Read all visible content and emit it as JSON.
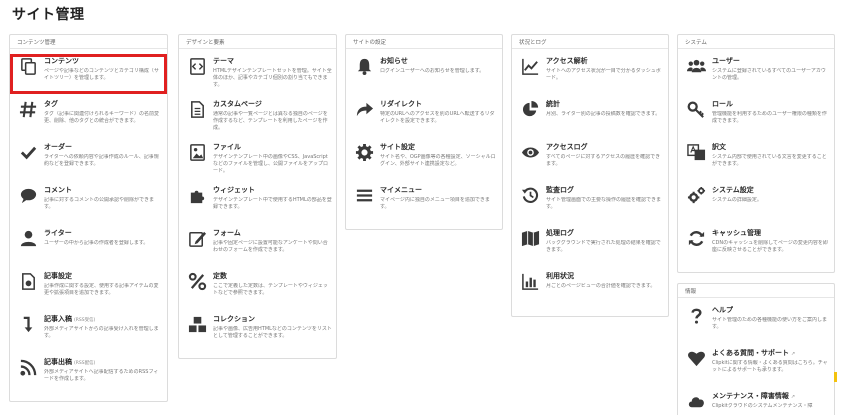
{
  "page": {
    "title": "サイト管理"
  },
  "panels": {
    "content": {
      "header": "コンテンツ管理",
      "items": [
        {
          "title": "コンテンツ",
          "tag": "",
          "desc": "ページや記事などのコンテンツとカテゴリ構成（サイトツリー）を管理します。"
        },
        {
          "title": "タグ",
          "tag": "",
          "desc": "タグ（記事に関連付けられるキーワード）の名前変更、削除、他のタグとの統合ができます。"
        },
        {
          "title": "オーダー",
          "tag": "",
          "desc": "ライターへの依頼内容や記事作成のルール、記事規約などを登録できます。"
        },
        {
          "title": "コメント",
          "tag": "",
          "desc": "記事に対するコメントの公開承認や削除ができます。"
        },
        {
          "title": "ライター",
          "tag": "",
          "desc": "ユーザーの中から記事の作成者を登録します。"
        },
        {
          "title": "記事設定",
          "tag": "",
          "desc": "記事作成に関する設定、使用する記事アイテムの変更や拡張項目を追加できます。"
        },
        {
          "title": "記事入稿",
          "tag": "(RSS受信)",
          "desc": "外部メディアサイトからの記事受け入れを管理します。"
        },
        {
          "title": "記事出稿",
          "tag": "(RSS配信)",
          "desc": "外部メディアサイトへ記事配信するためのRSSフィードを作成します。"
        }
      ]
    },
    "design": {
      "header": "デザインと要素",
      "items": [
        {
          "title": "テーマ",
          "desc": "HTMLデザインテンプレートセットを管理。サイト全体のほか、記事やカテゴリ個別の割り当てもできます。"
        },
        {
          "title": "カスタムページ",
          "desc": "通常の記事や一覧ページとは異なる独自のページを作成するなど、テンプレートを利用したページを作成。"
        },
        {
          "title": "ファイル",
          "desc": "デザインテンプレート中の画像やCSS、JavaScriptなどのファイルを管理し、公開ファイルをアップロード。"
        },
        {
          "title": "ウィジェット",
          "desc": "デザインテンプレート中で使用するHTMLの部品を登録できます。"
        },
        {
          "title": "フォーム",
          "desc": "記事や固定ページに設置可能なアンケートや問い合わせのフォームを作成できます。"
        },
        {
          "title": "定数",
          "desc": "ここで定義した定数は、テンプレートやウィジェットなどで参照できます。"
        },
        {
          "title": "コレクション",
          "desc": "記事や画像、広告用HTMLなどのコンテンツをリストとして管理することができます。"
        }
      ]
    },
    "site": {
      "header": "サイトの設定",
      "items": [
        {
          "title": "お知らせ",
          "desc": "ログインユーザーへのお知らせを管理します。"
        },
        {
          "title": "リダイレクト",
          "desc": "特定のURLへのアクセスを別のURLへ転送するリダイレクトを設定できます。"
        },
        {
          "title": "サイト設定",
          "desc": "サイト名や、OGP画像等の各種設定、ソーシャルログイン、外部サイト連携設定など。"
        },
        {
          "title": "マイメニュー",
          "desc": "マイページ内に独自のメニュー項目を追加できます。"
        }
      ]
    },
    "status": {
      "header": "状況とログ",
      "items": [
        {
          "title": "アクセス解析",
          "desc": "サイトへのアクセス状況が一目で分かるダッシュボード。"
        },
        {
          "title": "統計",
          "desc": "月別、ライター別の記事の投稿数を確認できます。"
        },
        {
          "title": "アクセスログ",
          "desc": "すべてのページに対するアクセスの履歴を確認できます。"
        },
        {
          "title": "監査ログ",
          "desc": "サイト管理画面での主要な操作の履歴を確認できます。"
        },
        {
          "title": "処理ログ",
          "desc": "バックグラウンドで実行された処理の結果を確認できます。"
        },
        {
          "title": "利用状況",
          "desc": "月ごとのページビューの合計値を確認できます。"
        }
      ]
    },
    "system": {
      "header": "システム",
      "items": [
        {
          "title": "ユーザー",
          "desc": "システムに登録されているすべてのユーザーアカウントの管理。"
        },
        {
          "title": "ロール",
          "desc": "管理機能を利用するためのユーザー権限の種類を作成できます。"
        },
        {
          "title": "訳文",
          "desc": "システム内部で使用されている文言を変更することができます。"
        },
        {
          "title": "システム設定",
          "desc": "システムの詳細設定。"
        },
        {
          "title": "キャッシュ管理",
          "desc": "CDNのキャッシュを削除してページの変更内容を即座に反映させることができます。"
        }
      ]
    },
    "info": {
      "header": "情報",
      "items": [
        {
          "title": "ヘルプ",
          "desc": "サイト管理のための各種機能の使い方をご案内します。"
        },
        {
          "title": "よくある質問・サポート",
          "desc": "Clipkitに関する情報・よくある質問はこちら。チャットによるサポートも承ります。"
        },
        {
          "title": "メンテナンス・障害情報",
          "desc": "Clipkitクラウドのシステムメンテナンス・障"
        }
      ]
    }
  },
  "colors": {
    "highlight": "#e02020",
    "accent": "#f4c20d",
    "icon": "#3a3a3a"
  }
}
